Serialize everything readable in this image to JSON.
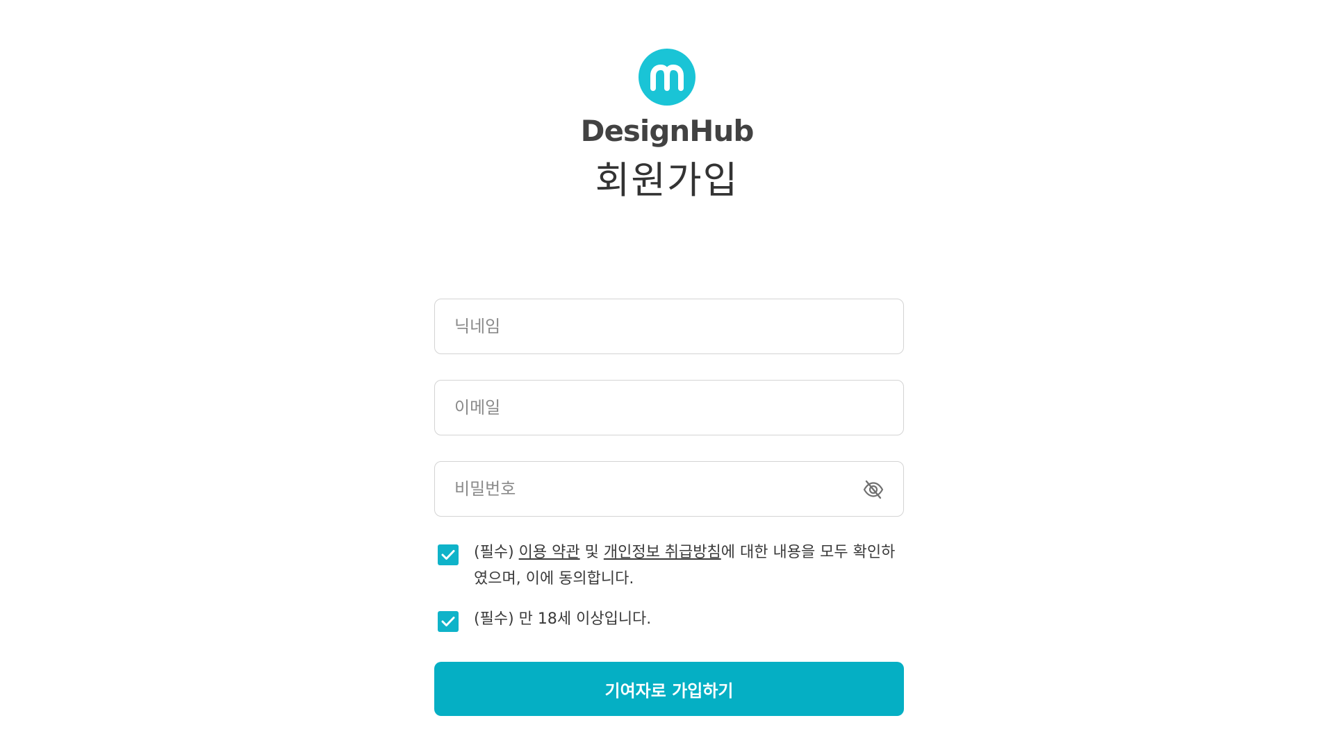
{
  "brand": {
    "logo_icon": "letter-m-logo-icon",
    "name": "DesignHub",
    "accent_color": "#1ac4d6"
  },
  "page": {
    "title": "회원가입"
  },
  "form": {
    "nickname": {
      "placeholder": "닉네임",
      "value": ""
    },
    "email": {
      "placeholder": "이메일",
      "value": ""
    },
    "password": {
      "placeholder": "비밀번호",
      "value": "",
      "toggle_icon": "eye-slash-icon"
    },
    "terms": {
      "checked": true,
      "prefix": "(필수) ",
      "terms_link": "이용 약관",
      "and": " 및 ",
      "privacy_link": "개인정보 취급방침",
      "suffix": "에 대한 내용을 모두 확인하였으며, 이에 동의합니다."
    },
    "age": {
      "checked": true,
      "label": "(필수) 만 18세 이상입니다."
    },
    "submit_label": "기여자로 가입하기",
    "button_color": "#05afc4"
  }
}
